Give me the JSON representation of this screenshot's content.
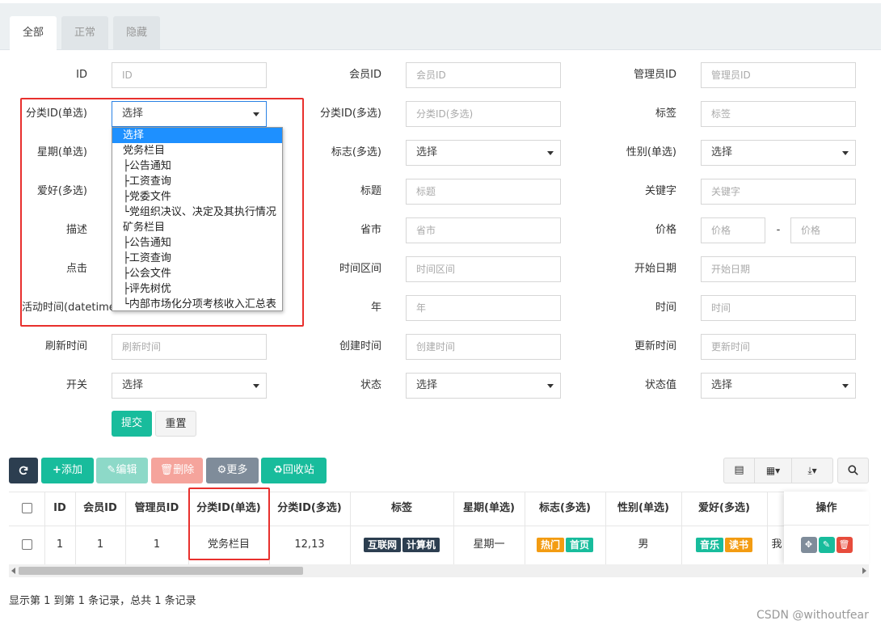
{
  "tabs": [
    {
      "label": "全部",
      "active": true
    },
    {
      "label": "正常",
      "active": false
    },
    {
      "label": "隐藏",
      "active": false
    }
  ],
  "form": {
    "row1": {
      "id_label": "ID",
      "id_placeholder": "ID",
      "member_label": "会员ID",
      "member_placeholder": "会员ID",
      "admin_label": "管理员ID",
      "admin_placeholder": "管理员ID"
    },
    "row2": {
      "cat_single_label": "分类ID(单选)",
      "cat_single_value": "选择",
      "cat_multi_label": "分类ID(多选)",
      "cat_multi_placeholder": "分类ID(多选)",
      "tag_label": "标签",
      "tag_placeholder": "标签"
    },
    "row3": {
      "week_label": "星期(单选)",
      "flag_label": "标志(多选)",
      "flag_value": "选择",
      "gender_label": "性别(单选)",
      "gender_value": "选择"
    },
    "row4": {
      "hobby_label": "爱好(多选)",
      "title_label": "标题",
      "title_placeholder": "标题",
      "keyword_label": "关键字",
      "keyword_placeholder": "关键字"
    },
    "row5": {
      "desc_label": "描述",
      "city_label": "省市",
      "city_placeholder": "省市",
      "price_label": "价格",
      "price_min_placeholder": "价格",
      "price_sep": "-",
      "price_max_placeholder": "价格"
    },
    "row6": {
      "click_label": "点击",
      "range_label": "时间区间",
      "range_placeholder": "时间区间",
      "start_label": "开始日期",
      "start_placeholder": "开始日期"
    },
    "row7": {
      "active_label": "活动时间(datetime",
      "year_label": "年",
      "year_placeholder": "年",
      "time_label": "时间",
      "time_placeholder": "时间"
    },
    "row8": {
      "refresh_label": "刷新时间",
      "refresh_placeholder": "刷新时间",
      "create_label": "创建时间",
      "create_placeholder": "创建时间",
      "update_label": "更新时间",
      "update_placeholder": "更新时间"
    },
    "row9": {
      "switch_label": "开关",
      "switch_value": "选择",
      "status_label": "状态",
      "status_value": "选择",
      "statusval_label": "状态值",
      "statusval_value": "选择"
    },
    "submit_label": "提交",
    "reset_label": "重置"
  },
  "dropdown": {
    "options": [
      "选择",
      "党务栏目",
      " ├公告通知",
      " ├工资查询",
      " ├党委文件",
      " └党组织决议、决定及其执行情况",
      "矿务栏目",
      " ├公告通知",
      " ├工资查询",
      " ├公会文件",
      " ├评先树优",
      " └内部市场化分项考核收入汇总表"
    ],
    "selected_index": 0
  },
  "toolbar": {
    "add": "添加",
    "edit": "编辑",
    "delete": "删除",
    "more": "更多",
    "recycle": "回收站"
  },
  "table": {
    "headers": [
      "ID",
      "会员ID",
      "管理员ID",
      "分类ID(单选)",
      "分类ID(多选)",
      "标签",
      "星期(单选)",
      "标志(多选)",
      "性别(单选)",
      "爱好(多选)",
      "操作"
    ],
    "row": {
      "id": "1",
      "member": "1",
      "admin": "1",
      "cat_single": "党务栏目",
      "cat_multi": "12,13",
      "tags": [
        "互联网",
        "计算机"
      ],
      "week": "星期一",
      "flags": [
        "热门",
        "首页"
      ],
      "gender": "男",
      "hobbies": [
        "音乐",
        "读书"
      ],
      "cut_text": "我"
    }
  },
  "pagination_text": "显示第 1 到第 1 条记录，总共 1 条记录",
  "watermark": "CSDN @withoutfear",
  "colors": {
    "primary": "#18bc9c",
    "danger": "#e74c3c",
    "dark": "#2c3e50",
    "highlight": "#e8302d",
    "select_blue": "#1e90ff"
  }
}
